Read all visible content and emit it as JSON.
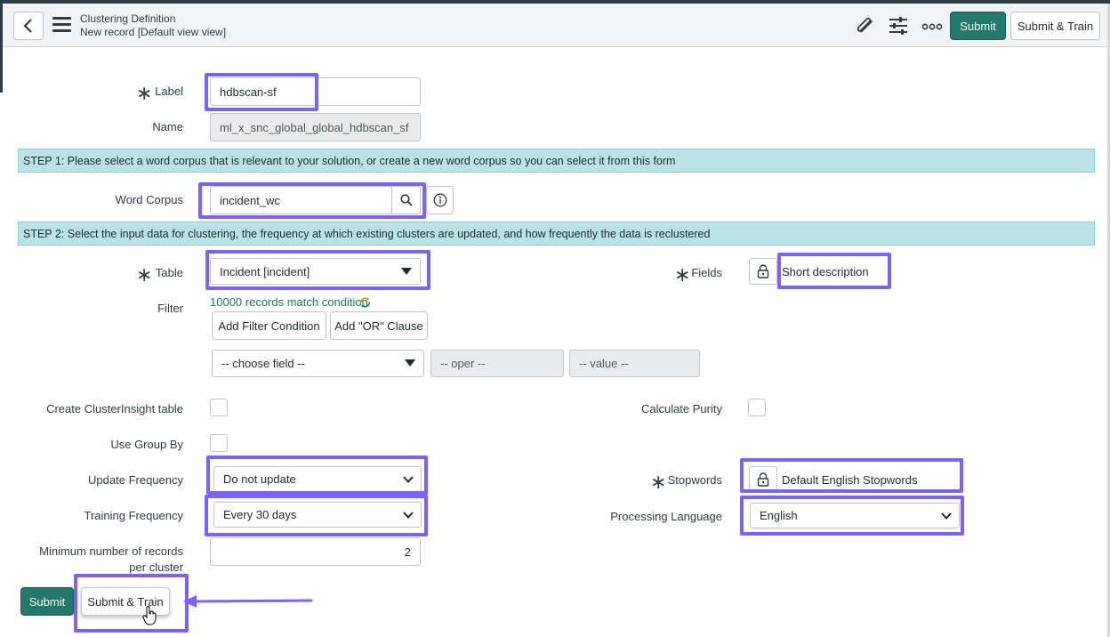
{
  "header": {
    "title": "Clustering Definition",
    "subtitle": "New record [Default view view]",
    "submit_label": "Submit",
    "submit_train_label": "Submit & Train"
  },
  "form": {
    "label": {
      "label": "Label",
      "value": "hdbscan-sf"
    },
    "name": {
      "label": "Name",
      "value": "ml_x_snc_global_global_hdbscan_sf"
    },
    "step1": "STEP 1: Please select a word corpus that is relevant to your solution, or create a new word corpus so you can select it from this form",
    "word_corpus": {
      "label": "Word Corpus",
      "value": "incident_wc"
    },
    "step2": "STEP 2: Select the input data for clustering, the frequency at which existing clusters are updated, and how frequently the data is reclustered",
    "table": {
      "label": "Table",
      "value": "Incident [incident]"
    },
    "fields": {
      "label": "Fields",
      "value": "Short description"
    },
    "filter": {
      "label": "Filter",
      "match_text": "10000 records match condition",
      "add_condition": "Add Filter Condition",
      "add_or": "Add \"OR\" Clause",
      "choose_field": "-- choose field --",
      "oper": "-- oper --",
      "value": "-- value --"
    },
    "cluster_insight": {
      "label": "Create ClusterInsight table"
    },
    "calc_purity": {
      "label": "Calculate Purity"
    },
    "group_by": {
      "label": "Use Group By"
    },
    "update_freq": {
      "label": "Update Frequency",
      "value": "Do not update"
    },
    "stopwords": {
      "label": "Stopwords",
      "value": "Default English Stopwords"
    },
    "training_freq": {
      "label": "Training Frequency",
      "value": "Every 30 days"
    },
    "proc_lang": {
      "label": "Processing Language",
      "value": "English"
    },
    "min_records": {
      "label_line1": "Minimum number of records",
      "label_line2": "per cluster",
      "value": "2"
    }
  },
  "footer": {
    "submit_label": "Submit",
    "submit_train_label": "Submit & Train"
  },
  "colors": {
    "primary": "#22786a",
    "highlight": "#7b61ff",
    "banner": "#b9e3e6"
  }
}
